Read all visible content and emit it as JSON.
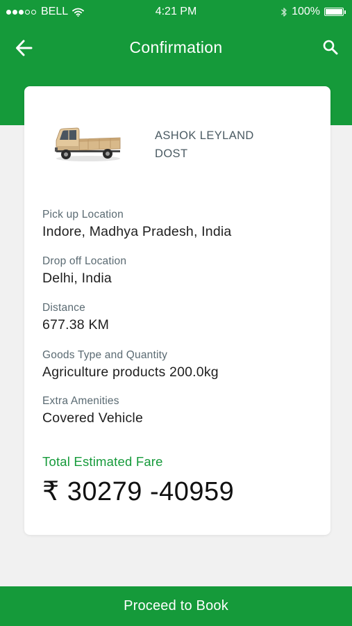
{
  "status_bar": {
    "carrier": "BELL",
    "time": "4:21 PM",
    "battery": "100%"
  },
  "header": {
    "title": "Confirmation",
    "back_icon": "arrow-left-icon",
    "search_icon": "search-icon"
  },
  "vehicle": {
    "name_line1": "ASHOK LEYLAND",
    "name_line2": "DOST",
    "image_icon": "pickup-truck-image"
  },
  "details": [
    {
      "label": "Pick up Location",
      "value": "Indore, Madhya Pradesh, India"
    },
    {
      "label": "Drop off Location",
      "value": "Delhi, India"
    },
    {
      "label": "Distance",
      "value": "677.38 KM"
    },
    {
      "label": "Goods Type and Quantity",
      "value": "Agriculture products 200.0kg"
    },
    {
      "label": "Extra Amenities",
      "value": "Covered Vehicle"
    }
  ],
  "fare": {
    "label": "Total Estimated Fare",
    "value": "₹ 30279 -40959"
  },
  "footer": {
    "proceed_label": "Proceed to Book"
  },
  "colors": {
    "brand_green": "#159a3a",
    "background": "#f1f1f1"
  }
}
